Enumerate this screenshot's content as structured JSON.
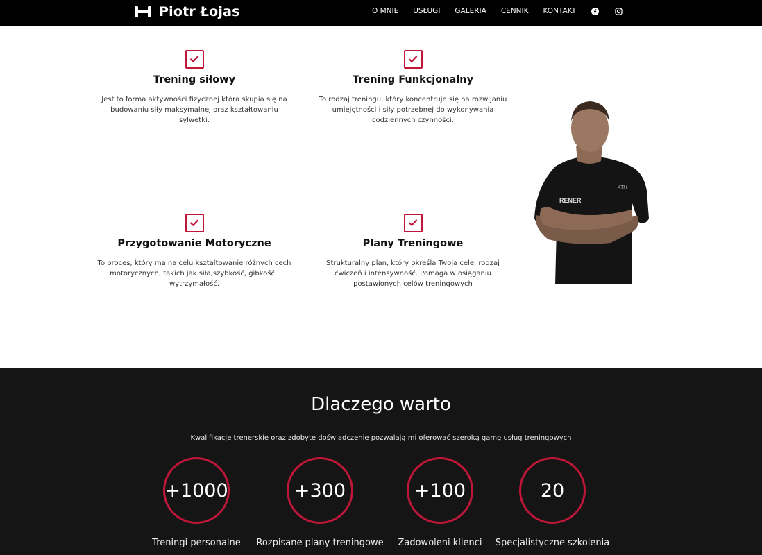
{
  "brand": {
    "name": "Piotr Łojas",
    "icon": "dumbbell-icon"
  },
  "nav": {
    "items": [
      "O MNIE",
      "USŁUGI",
      "GALERIA",
      "CENNIK",
      "KONTAKT"
    ],
    "social": [
      "facebook-icon",
      "instagram-icon"
    ]
  },
  "services": [
    {
      "title": "Trening siłowy",
      "description": "Jest to forma aktywności fizycznej która skupia się na budowaniu siły maksymalnej oraz kształtowaniu sylwetki."
    },
    {
      "title": "Trening Funkcjonalny",
      "description": "To rodzaj treningu, który koncentruje się na rozwijaniu umiejętności i siły potrzebnej do wykonywania codziennych czynności."
    },
    {
      "title": "Przygotowanie Motoryczne",
      "description": "To proces, który ma na celu kształtowanie różnych cech motorycznych, takich jak siła,szybkość, gibkość i wytrzymałość."
    },
    {
      "title": "Plany Treningowe",
      "description": "Strukturalny plan, który określa Twoja cele, rodzaj ćwiczeń i intensywność. Pomaga w osiąganiu postawionych celów treningowych"
    }
  ],
  "why": {
    "title": "Dlaczego warto",
    "intro": "Kwalifikacje trenerskie oraz zdobyte doświadczenie pozwalają mi oferować szeroką gamę usług treningowych",
    "stats": [
      {
        "value": "+1000",
        "label": "Treningi personalne"
      },
      {
        "value": "+300",
        "label": "Rozpisane plany treningowe"
      },
      {
        "value": "+100",
        "label": "Zadowoleni klienci"
      },
      {
        "value": "20",
        "label": "Specjalistyczne szkolenia"
      }
    ]
  },
  "colors": {
    "accent": "#c0163a",
    "header_bg": "#000000",
    "dark_bg": "#151515"
  }
}
